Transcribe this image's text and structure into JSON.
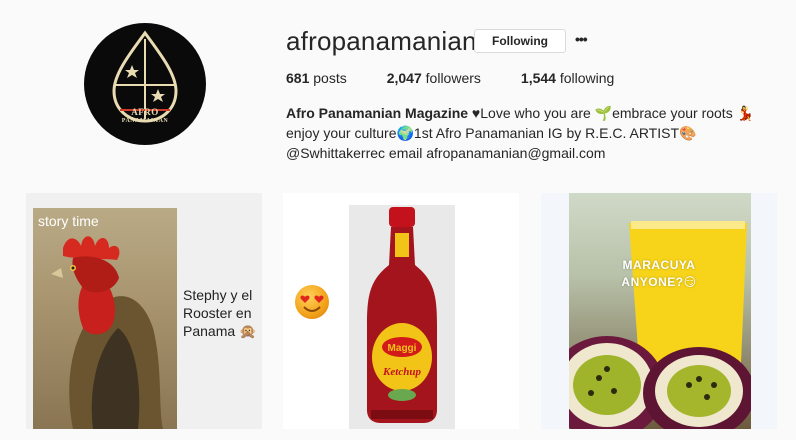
{
  "profile": {
    "username": "afropanamanian",
    "follow_button": "Following",
    "more_label": "•••",
    "avatar_line1": "AFRO",
    "avatar_line2": "PANAMANIAN"
  },
  "stats": {
    "posts_count": "681",
    "posts_label": " posts",
    "followers_count": "2,047",
    "followers_label": " followers",
    "following_count": "1,544",
    "following_label": " following"
  },
  "bio": {
    "name": "Afro Panamanian Magazine",
    "text": " ♥Love who you are 🌱embrace your roots 💃enjoy your culture🌍1st Afro Panamanian IG by R.E.C. ARTIST🎨@Swhittakerrec email afropanamanian@gmail.com"
  },
  "posts": [
    {
      "caption": "story time",
      "text": "Stephy y el Rooster en Panama 🙊"
    },
    {
      "label": "Maggi",
      "sublabel": "Ketchup"
    },
    {
      "caption_line1": "MARACUYA",
      "caption_line2": "ANYONE?😏"
    }
  ],
  "colors": {
    "background": "#fafafa",
    "text": "#262626",
    "border": "#dbdbdb",
    "avatar_gold": "#e9dcb2"
  },
  "icons": {
    "more": "ellipsis-icon",
    "avatar_stars": "star-icon"
  }
}
